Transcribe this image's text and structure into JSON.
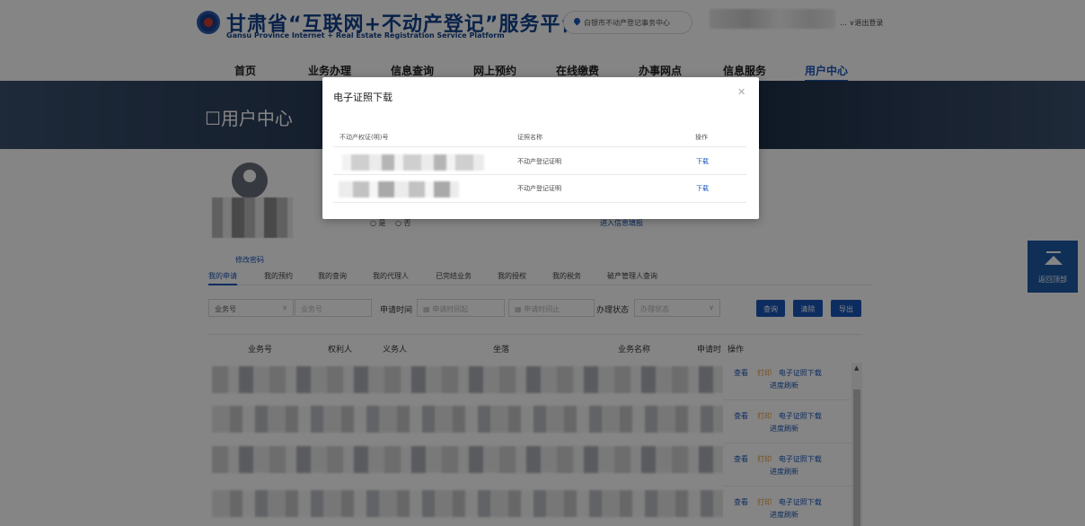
{
  "header": {
    "title": "甘肃省“互联网+不动产登记”服务平台",
    "subtitle": "Gansu Province Internet + Real Estate Registration Service Platform",
    "location": "白银市不动产登记事务中心",
    "logout": "退出登录"
  },
  "nav": [
    "首页",
    "业务办理",
    "信息查询",
    "网上预约",
    "在线缴费",
    "办事网点",
    "信息服务",
    "用户中心"
  ],
  "banner": {
    "title": "用户中心"
  },
  "profile": {
    "edit_password": "修改密码",
    "radio_yes": "是",
    "radio_no": "否",
    "link": "进入信息填报"
  },
  "tabs": [
    "我的申请",
    "我的预约",
    "我的查询",
    "我的代理人",
    "已完结业务",
    "我的授权",
    "我的税务",
    "破产管理人查询"
  ],
  "filters": {
    "type_select": "业务号",
    "type_placeholder": "业务号",
    "date_label": "申请时间",
    "date_start_placeholder": "申请时间起",
    "date_end_placeholder": "申请时间止",
    "status_label": "办理状态",
    "status_placeholder": "办理状态",
    "query_btn": "查询",
    "reset_btn": "清除",
    "export_btn": "导出"
  },
  "table": {
    "headers": [
      "业务号",
      "权利人",
      "义务人",
      "坐落",
      "业务名称",
      "申请时",
      "操作"
    ],
    "row_actions": {
      "view": "查看",
      "print": "打印",
      "cert": "电子证照下载",
      "progress": "进度刷新"
    },
    "row_count": 4
  },
  "back_to_top": "返回顶部",
  "modal": {
    "title": "电子证照下载",
    "columns": [
      "不动产权证(明)号",
      "证照名称",
      "操作"
    ],
    "rows": [
      {
        "cert_name": "不动产登记证明",
        "action": "下载"
      },
      {
        "cert_name": "不动产登记证明",
        "action": "下载"
      }
    ]
  }
}
